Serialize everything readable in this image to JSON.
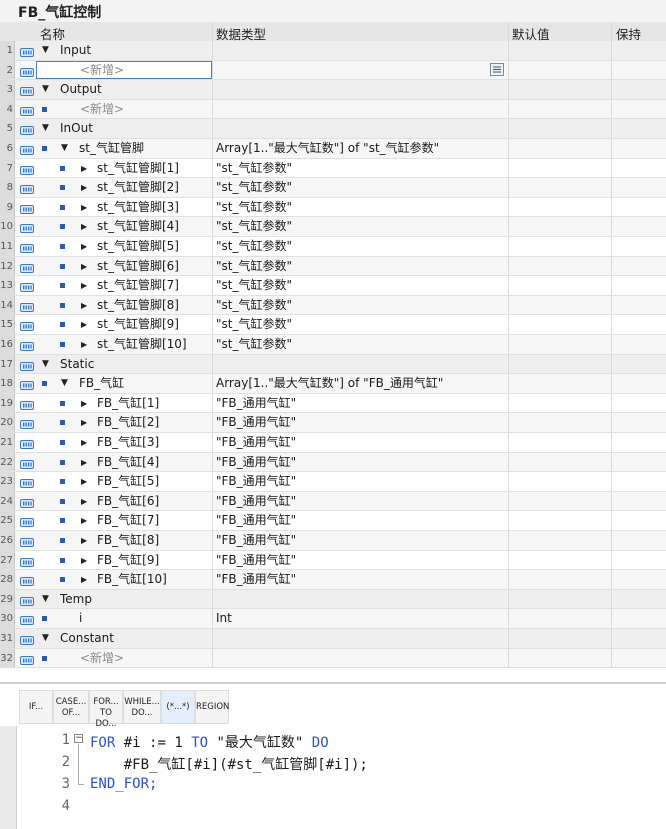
{
  "title": "FB_气缸控制",
  "columns": {
    "name": "名称",
    "type": "数据类型",
    "default": "默认值",
    "retain": "保持"
  },
  "rows": [
    {
      "num": "1",
      "kind": "section",
      "name": "Input",
      "type": "",
      "level": 0,
      "expand": "down",
      "io": true
    },
    {
      "num": "2",
      "kind": "add-edit",
      "name": "<新增>",
      "type": "",
      "level": 1,
      "io": true
    },
    {
      "num": "3",
      "kind": "section",
      "name": "Output",
      "type": "",
      "level": 0,
      "expand": "down",
      "io": true
    },
    {
      "num": "4",
      "kind": "add",
      "name": "<新增>",
      "type": "",
      "level": 1,
      "io": true
    },
    {
      "num": "5",
      "kind": "section",
      "name": "InOut",
      "type": "",
      "level": 0,
      "expand": "down",
      "io": true
    },
    {
      "num": "6",
      "kind": "item",
      "name": "st_气缸管脚",
      "type": "Array[1..\"最大气缸数\"] of \"st_气缸参数\"",
      "level": 1,
      "expand": "down",
      "io": true
    },
    {
      "num": "7",
      "kind": "item",
      "name": "st_气缸管脚[1]",
      "type": "\"st_气缸参数\"",
      "level": 2,
      "expand": "right",
      "io": true
    },
    {
      "num": "8",
      "kind": "item",
      "name": "st_气缸管脚[2]",
      "type": "\"st_气缸参数\"",
      "level": 2,
      "expand": "right",
      "io": true
    },
    {
      "num": "9",
      "kind": "item",
      "name": "st_气缸管脚[3]",
      "type": "\"st_气缸参数\"",
      "level": 2,
      "expand": "right",
      "io": true
    },
    {
      "num": "10",
      "kind": "item",
      "name": "st_气缸管脚[4]",
      "type": "\"st_气缸参数\"",
      "level": 2,
      "expand": "right",
      "io": true
    },
    {
      "num": "11",
      "kind": "item",
      "name": "st_气缸管脚[5]",
      "type": "\"st_气缸参数\"",
      "level": 2,
      "expand": "right",
      "io": true
    },
    {
      "num": "12",
      "kind": "item",
      "name": "st_气缸管脚[6]",
      "type": "\"st_气缸参数\"",
      "level": 2,
      "expand": "right",
      "io": true
    },
    {
      "num": "13",
      "kind": "item",
      "name": "st_气缸管脚[7]",
      "type": "\"st_气缸参数\"",
      "level": 2,
      "expand": "right",
      "io": true
    },
    {
      "num": "14",
      "kind": "item",
      "name": "st_气缸管脚[8]",
      "type": "\"st_气缸参数\"",
      "level": 2,
      "expand": "right",
      "io": true
    },
    {
      "num": "15",
      "kind": "item",
      "name": "st_气缸管脚[9]",
      "type": "\"st_气缸参数\"",
      "level": 2,
      "expand": "right",
      "io": true
    },
    {
      "num": "16",
      "kind": "item",
      "name": "st_气缸管脚[10]",
      "type": "\"st_气缸参数\"",
      "level": 2,
      "expand": "right",
      "io": true
    },
    {
      "num": "17",
      "kind": "section",
      "name": "Static",
      "type": "",
      "level": 0,
      "expand": "down",
      "io": true
    },
    {
      "num": "18",
      "kind": "item",
      "name": "FB_气缸",
      "type": "Array[1..\"最大气缸数\"] of \"FB_通用气缸\"",
      "level": 1,
      "expand": "down",
      "io": true
    },
    {
      "num": "19",
      "kind": "item",
      "name": "FB_气缸[1]",
      "type": "\"FB_通用气缸\"",
      "level": 2,
      "expand": "right",
      "io": true
    },
    {
      "num": "20",
      "kind": "item",
      "name": "FB_气缸[2]",
      "type": "\"FB_通用气缸\"",
      "level": 2,
      "expand": "right",
      "io": true
    },
    {
      "num": "21",
      "kind": "item",
      "name": "FB_气缸[3]",
      "type": "\"FB_通用气缸\"",
      "level": 2,
      "expand": "right",
      "io": true
    },
    {
      "num": "22",
      "kind": "item",
      "name": "FB_气缸[4]",
      "type": "\"FB_通用气缸\"",
      "level": 2,
      "expand": "right",
      "io": true
    },
    {
      "num": "23",
      "kind": "item",
      "name": "FB_气缸[5]",
      "type": "\"FB_通用气缸\"",
      "level": 2,
      "expand": "right",
      "io": true
    },
    {
      "num": "24",
      "kind": "item",
      "name": "FB_气缸[6]",
      "type": "\"FB_通用气缸\"",
      "level": 2,
      "expand": "right",
      "io": true
    },
    {
      "num": "25",
      "kind": "item",
      "name": "FB_气缸[7]",
      "type": "\"FB_通用气缸\"",
      "level": 2,
      "expand": "right",
      "io": true
    },
    {
      "num": "26",
      "kind": "item",
      "name": "FB_气缸[8]",
      "type": "\"FB_通用气缸\"",
      "level": 2,
      "expand": "right",
      "io": true
    },
    {
      "num": "27",
      "kind": "item",
      "name": "FB_气缸[9]",
      "type": "\"FB_通用气缸\"",
      "level": 2,
      "expand": "right",
      "io": true
    },
    {
      "num": "28",
      "kind": "item",
      "name": "FB_气缸[10]",
      "type": "\"FB_通用气缸\"",
      "level": 2,
      "expand": "right",
      "io": true
    },
    {
      "num": "29",
      "kind": "section",
      "name": "Temp",
      "type": "",
      "level": 0,
      "expand": "down",
      "io": true
    },
    {
      "num": "30",
      "kind": "leaf",
      "name": "i",
      "type": "Int",
      "level": 1,
      "io": true
    },
    {
      "num": "31",
      "kind": "section",
      "name": "Constant",
      "type": "",
      "level": 0,
      "expand": "down",
      "io": true
    },
    {
      "num": "32",
      "kind": "add",
      "name": "<新增>",
      "type": "",
      "level": 1,
      "io": true
    }
  ],
  "toolbar": [
    {
      "label1": "IF...",
      "label2": ""
    },
    {
      "label1": "CASE...",
      "label2": "OF..."
    },
    {
      "label1": "FOR...",
      "label2": "TO DO..."
    },
    {
      "label1": "WHILE...",
      "label2": "DO..."
    },
    {
      "label1": "(*...*)",
      "label2": ""
    },
    {
      "label1": "REGION",
      "label2": ""
    }
  ],
  "code_lines": [
    {
      "num": "1",
      "text": "FOR #i := 1 TO \"最大气缸数\" DO"
    },
    {
      "num": "2",
      "text": "    #FB_气缸[#i](#st_气缸管脚[#i]);"
    },
    {
      "num": "3",
      "text": "END_FOR;"
    },
    {
      "num": "4",
      "text": ""
    }
  ],
  "colors": {
    "accent": "#2a52c8",
    "io_icon": "#3a78c8",
    "selection": "#4a7fc2"
  }
}
